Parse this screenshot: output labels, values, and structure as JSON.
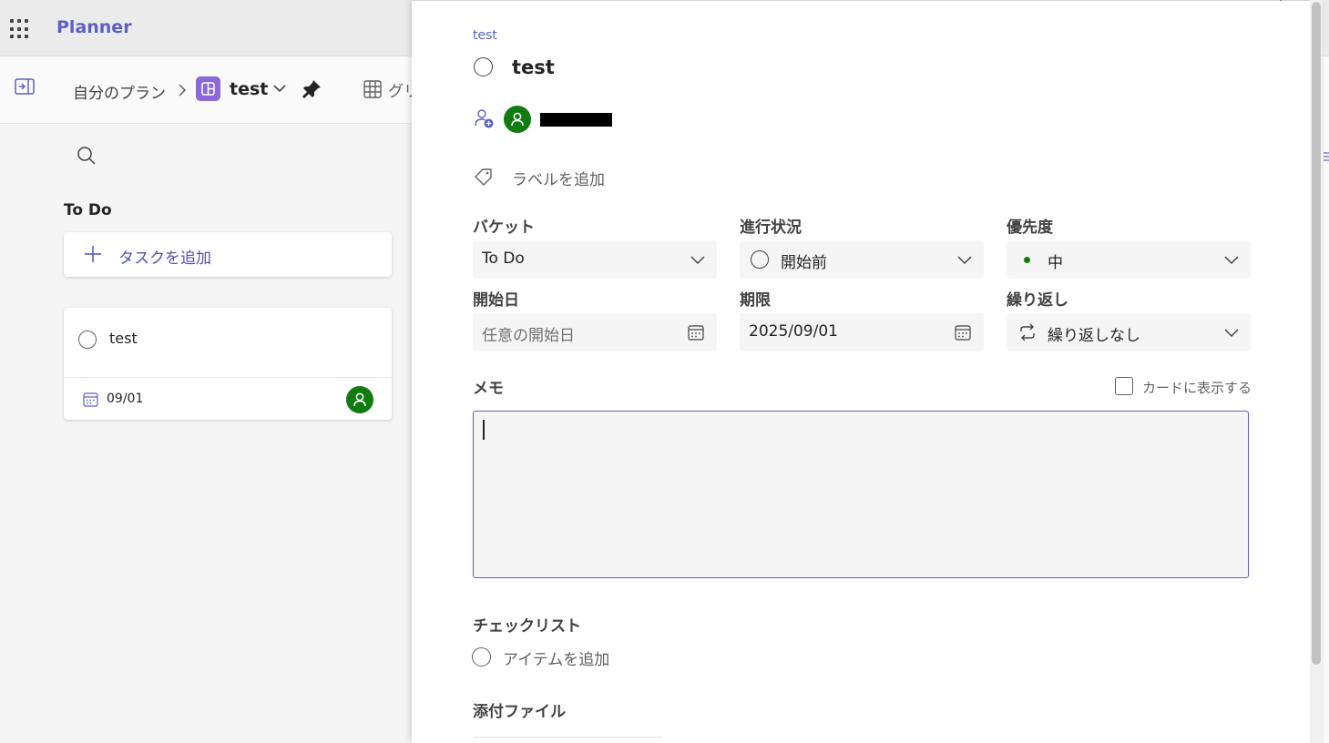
{
  "app": {
    "name": "Planner"
  },
  "breadcrumb": {
    "root": "自分のプラン",
    "separator": ">",
    "plan_name": "test",
    "view_label": "グリ"
  },
  "board": {
    "bucket_title": "To Do",
    "add_task_label": "タスクを追加",
    "tasks": [
      {
        "title": "test",
        "due": "09/01"
      }
    ]
  },
  "detail": {
    "plan_label": "test",
    "title": "test",
    "add_label": "ラベルを追加",
    "bucket": {
      "label": "バケット",
      "value": "To Do"
    },
    "progress": {
      "label": "進行状況",
      "value": "開始前"
    },
    "priority": {
      "label": "優先度",
      "value": "中"
    },
    "start_date": {
      "label": "開始日",
      "placeholder": "任意の開始日"
    },
    "due_date": {
      "label": "期限",
      "value": "2025/09/01"
    },
    "repeat": {
      "label": "繰り返し",
      "value": "繰り返しなし"
    },
    "memo": {
      "label": "メモ",
      "value": "",
      "show_on_card_label": "カードに表示する",
      "show_on_card": false
    },
    "checklist": {
      "label": "チェックリスト",
      "add_item_label": "アイテムを追加"
    },
    "attachments": {
      "label": "添付ファイル"
    }
  },
  "colors": {
    "brand": "#5b5fc7",
    "avatar": "#107c10",
    "priority_dot": "#107c10",
    "plan_icon": "#8a6ad8"
  },
  "icons": [
    "waffle-icon",
    "panel-collapse-icon",
    "chevron-right-icon",
    "plan-icon",
    "chevron-down-icon",
    "pin-icon",
    "grid-icon",
    "search-icon",
    "plus-icon",
    "calendar-icon",
    "person-icon",
    "add-person-icon",
    "tag-icon",
    "repeat-icon",
    "close-icon"
  ]
}
